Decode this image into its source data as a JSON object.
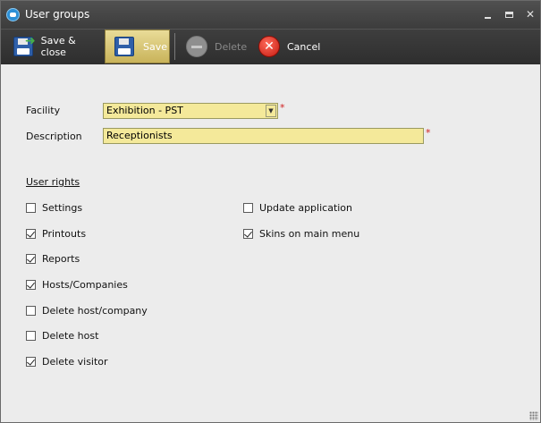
{
  "window": {
    "title": "User groups"
  },
  "toolbar": {
    "save_close_label": "Save & close",
    "save_label": "Save",
    "delete_label": "Delete",
    "cancel_label": "Cancel"
  },
  "form": {
    "facility_label": "Facility",
    "facility_value": "Exhibition - PST",
    "description_label": "Description",
    "description_value": "Receptionists",
    "required_mark": "*"
  },
  "user_rights": {
    "title": "User rights",
    "left": [
      {
        "label": "Settings",
        "checked": false
      },
      {
        "label": "Printouts",
        "checked": true
      },
      {
        "label": "Reports",
        "checked": true
      },
      {
        "label": "Hosts/Companies",
        "checked": true
      },
      {
        "label": "Delete host/company",
        "checked": false
      },
      {
        "label": "Delete host",
        "checked": false
      },
      {
        "label": "Delete visitor",
        "checked": true
      }
    ],
    "right": [
      {
        "label": "Update application",
        "checked": false
      },
      {
        "label": "Skins on main menu",
        "checked": true
      }
    ]
  },
  "colors": {
    "field_bg": "#f4e99a",
    "toolbar_bg": "#2e2e2e",
    "required": "#d02020"
  }
}
